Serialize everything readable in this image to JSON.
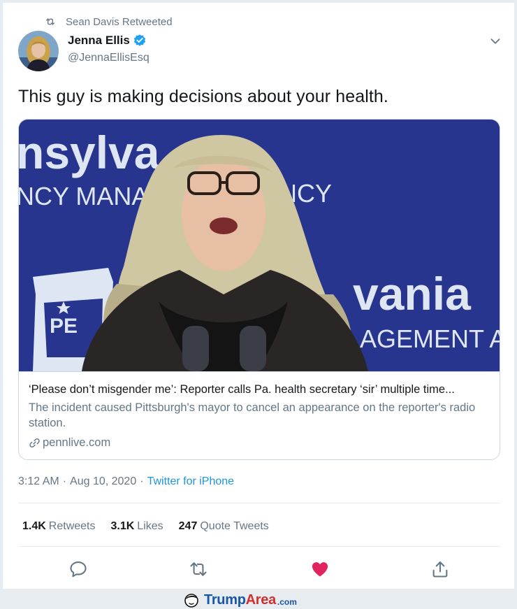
{
  "retweet": {
    "label": "Sean Davis Retweeted",
    "icon": "retweet-icon"
  },
  "author": {
    "display_name": "Jenna Ellis",
    "handle": "@JennaEllisEsq",
    "verified": true,
    "avatar": "profile-photo"
  },
  "tweet": {
    "text": "This guy is making decisions about your health."
  },
  "link_card": {
    "title": "‘Please don’t misgender me’: Reporter calls Pa. health secretary ‘sir’ multiple time...",
    "description": "The incident caused Pittsburgh's mayor to cancel an appearance on the reporter's radio station.",
    "domain": "pennlive.com",
    "image_backdrop_text": {
      "line1": "nsylva",
      "line2": "NCY MANAG",
      "line3": "NCY",
      "line4": "vania",
      "line5": "AGEMENT AC",
      "badge": "PE"
    }
  },
  "meta": {
    "time": "3:12 AM",
    "separator": "·",
    "date": "Aug 10, 2020",
    "separator2": "·",
    "source": "Twitter for iPhone"
  },
  "stats": {
    "retweets_count": "1.4K",
    "retweets_label": "Retweets",
    "likes_count": "3.1K",
    "likes_label": "Likes",
    "quotes_count": "247",
    "quotes_label": "Quote Tweets"
  },
  "actions": [
    "reply-icon",
    "retweet-icon",
    "like-icon",
    "share-icon"
  ],
  "colors": {
    "link_blue": "#1b95e0",
    "verified_blue": "#1da1f2",
    "like_red": "#e0245e",
    "secondary_text": "#657786",
    "backdrop_blue": "#27358e"
  },
  "watermark": {
    "part1": "Trump",
    "part2": "Area",
    "part3": ".com"
  }
}
